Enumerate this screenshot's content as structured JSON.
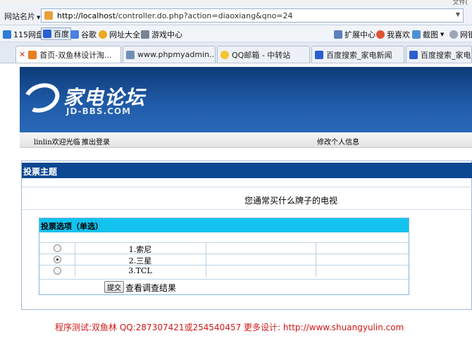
{
  "browser": {
    "top_right_text": "文件(",
    "site_label": "网站名片",
    "url_host": "http://localhost",
    "url_path": "/controller.do.php?action=diaoxiang&qno=24",
    "favorites": [
      "115网盘",
      "百度",
      "谷歌",
      "网址大全",
      "游戏中心"
    ],
    "favorites_right": [
      "扩展中心",
      "我喜欢",
      "截图",
      "网银"
    ],
    "tabs": [
      {
        "label": "首页-双鱼林设计淘..."
      },
      {
        "label": "www.phpmyadmin...."
      },
      {
        "label": "QQ邮箱 - 中转站"
      },
      {
        "label": "百度搜索_家电新闻"
      },
      {
        "label": "百度搜索_家电新闻"
      }
    ]
  },
  "banner": {
    "logo_cn": "家电论坛",
    "logo_en": "JD-BBS.COM"
  },
  "userbar": {
    "welcome": "linlin欢迎光临",
    "logout": "推出登录",
    "edit_info": "修改个人信息"
  },
  "poll": {
    "header": "投票主题",
    "question": "您通常买什么牌子的电视",
    "options_header": "投票选项（单选）",
    "options": [
      {
        "label": "1.索尼",
        "selected": false
      },
      {
        "label": "2.三星",
        "selected": true
      },
      {
        "label": "3.TCL",
        "selected": false
      }
    ],
    "submit_label": "提交",
    "result_link": "查看调查结果"
  },
  "footer": "程序测试:双鱼林 QQ:287307421或254540457 更多设计: http://www.shuangyulin.com"
}
